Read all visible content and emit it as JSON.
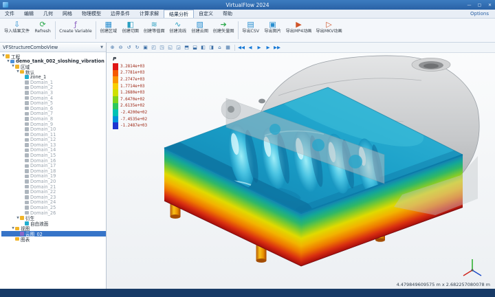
{
  "window": {
    "title": "VirtualFlow 2024",
    "minimize": "—",
    "maximize": "▢",
    "close": "✕",
    "options": "Options"
  },
  "menu": {
    "items": [
      "文件",
      "编辑",
      "几何",
      "网格",
      "物理模型",
      "边界条件",
      "计算求解",
      "结果分析",
      "自定义",
      "帮助"
    ],
    "active_index": 7
  },
  "ribbon": {
    "groups": [
      {
        "buttons": [
          {
            "id": "import-results",
            "label": "导入结果文件",
            "glyph": "⇩",
            "color": "#2a8fd0"
          },
          {
            "id": "refresh",
            "label": "Refresh",
            "glyph": "⟳",
            "color": "#2aa84a"
          }
        ]
      },
      {
        "buttons": [
          {
            "id": "create-variable",
            "label": "Create Variable",
            "glyph": "ƒ",
            "color": "#8a5fc0"
          }
        ]
      },
      {
        "buttons": [
          {
            "id": "create-region",
            "label": "创建区域",
            "glyph": "▦",
            "color": "#2a8fd0"
          },
          {
            "id": "create-slice",
            "label": "创建切面",
            "glyph": "◧",
            "color": "#2a9fc0"
          },
          {
            "id": "create-isosurface",
            "label": "创建等值面",
            "glyph": "≋",
            "color": "#2a9fc0"
          },
          {
            "id": "create-streamline",
            "label": "创建流线",
            "glyph": "∿",
            "color": "#2a9fc0"
          },
          {
            "id": "create-contour",
            "label": "创建云图",
            "glyph": "▨",
            "color": "#2a8fd0"
          },
          {
            "id": "create-vector",
            "label": "创建矢量图",
            "glyph": "➔",
            "color": "#2aa84a"
          }
        ]
      },
      {
        "buttons": [
          {
            "id": "export-csv",
            "label": "导出CSV",
            "glyph": "▤",
            "color": "#2a8fd0"
          },
          {
            "id": "export-image",
            "label": "导出图片",
            "glyph": "▣",
            "color": "#2a8fd0"
          },
          {
            "id": "export-mp4",
            "label": "导出MP4动画",
            "glyph": "▶",
            "color": "#d0552a"
          },
          {
            "id": "export-mkv",
            "label": "导出MKV动画",
            "glyph": "▷",
            "color": "#d0552a"
          }
        ]
      }
    ]
  },
  "sidebar": {
    "header": "VFStructureComboView",
    "tree": [
      {
        "label": "工程",
        "depth": 0,
        "icon": "folder",
        "exp": true
      },
      {
        "label": "demo_tank_002_sloshing_vibration",
        "depth": 1,
        "icon": "project",
        "exp": true,
        "bold": true
      },
      {
        "label": "区域",
        "depth": 2,
        "icon": "folder",
        "exp": true
      },
      {
        "label": "默认",
        "depth": 3,
        "icon": "folder",
        "exp": true
      },
      {
        "label": "zone_1",
        "depth": 4,
        "icon": "zone"
      },
      {
        "label": "Domain_1",
        "depth": 4,
        "icon": "domain",
        "gray": true
      },
      {
        "label": "Domain_2",
        "depth": 4,
        "icon": "domain",
        "gray": true
      },
      {
        "label": "Domain_3",
        "depth": 4,
        "icon": "domain",
        "gray": true
      },
      {
        "label": "Domain_4",
        "depth": 4,
        "icon": "domain",
        "gray": true
      },
      {
        "label": "Domain_5",
        "depth": 4,
        "icon": "domain",
        "gray": true
      },
      {
        "label": "Domain_6",
        "depth": 4,
        "icon": "domain",
        "gray": true
      },
      {
        "label": "Domain_7",
        "depth": 4,
        "icon": "domain",
        "gray": true
      },
      {
        "label": "Domain_8",
        "depth": 4,
        "icon": "domain",
        "gray": true
      },
      {
        "label": "Domain_9",
        "depth": 4,
        "icon": "domain",
        "gray": true
      },
      {
        "label": "Domain_10",
        "depth": 4,
        "icon": "domain",
        "gray": true
      },
      {
        "label": "Domain_11",
        "depth": 4,
        "icon": "domain",
        "gray": true
      },
      {
        "label": "Domain_12",
        "depth": 4,
        "icon": "domain",
        "gray": true
      },
      {
        "label": "Domain_13",
        "depth": 4,
        "icon": "domain",
        "gray": true
      },
      {
        "label": "Domain_14",
        "depth": 4,
        "icon": "domain",
        "gray": true
      },
      {
        "label": "Domain_15",
        "depth": 4,
        "icon": "domain",
        "gray": true
      },
      {
        "label": "Domain_16",
        "depth": 4,
        "icon": "domain",
        "gray": true
      },
      {
        "label": "Domain_17",
        "depth": 4,
        "icon": "domain",
        "gray": true
      },
      {
        "label": "Domain_18",
        "depth": 4,
        "icon": "domain",
        "gray": true
      },
      {
        "label": "Domain_19",
        "depth": 4,
        "icon": "domain",
        "gray": true
      },
      {
        "label": "Domain_20",
        "depth": 4,
        "icon": "domain",
        "gray": true
      },
      {
        "label": "Domain_21",
        "depth": 4,
        "icon": "domain",
        "gray": true
      },
      {
        "label": "Domain_22",
        "depth": 4,
        "icon": "domain",
        "gray": true
      },
      {
        "label": "Domain_23",
        "depth": 4,
        "icon": "domain",
        "gray": true
      },
      {
        "label": "Domain_24",
        "depth": 4,
        "icon": "domain",
        "gray": true
      },
      {
        "label": "Domain_25",
        "depth": 4,
        "icon": "domain",
        "gray": true
      },
      {
        "label": "Domain_26",
        "depth": 4,
        "icon": "domain",
        "gray": true
      },
      {
        "label": "衍生",
        "depth": 3,
        "icon": "folder",
        "exp": true
      },
      {
        "label": "自由液面",
        "depth": 4,
        "icon": "surface"
      },
      {
        "label": "视图",
        "depth": 2,
        "icon": "folder",
        "exp": true
      },
      {
        "label": "云图_02",
        "depth": 3,
        "icon": "view",
        "sel": true
      },
      {
        "label": "图表",
        "depth": 2,
        "icon": "folder"
      }
    ]
  },
  "viewport": {
    "tools": [
      {
        "name": "zoom-in-icon",
        "glyph": "⊕"
      },
      {
        "name": "zoom-out-icon",
        "glyph": "⊖"
      },
      {
        "name": "rotate-left-icon",
        "glyph": "↺"
      },
      {
        "name": "rotate-right-icon",
        "glyph": "↻"
      },
      {
        "name": "fit-view-icon",
        "glyph": "▣"
      },
      {
        "name": "view-front-icon",
        "glyph": "◰"
      },
      {
        "name": "view-back-icon",
        "glyph": "◳"
      },
      {
        "name": "view-left-icon",
        "glyph": "◱"
      },
      {
        "name": "view-right-icon",
        "glyph": "◲"
      },
      {
        "name": "view-top-icon",
        "glyph": "⬒"
      },
      {
        "name": "view-bottom-icon",
        "glyph": "⬓"
      },
      {
        "name": "view-iso-icon",
        "glyph": "◧"
      },
      {
        "name": "perspective-icon",
        "glyph": "◨"
      },
      {
        "name": "home-view-icon",
        "glyph": "⌂"
      },
      {
        "name": "grid-icon",
        "glyph": "▦"
      }
    ],
    "playback": [
      {
        "name": "skip-start-icon",
        "glyph": "◀◀"
      },
      {
        "name": "step-back-icon",
        "glyph": "◀"
      },
      {
        "name": "play-icon",
        "glyph": "▶"
      },
      {
        "name": "step-forward-icon",
        "glyph": "▶"
      },
      {
        "name": "skip-end-icon",
        "glyph": "▶▶"
      }
    ],
    "legend": {
      "title": "P",
      "entries": [
        {
          "value": "3.2814e+03",
          "color": "#e01616"
        },
        {
          "value": "2.7781e+03",
          "color": "#f55a00"
        },
        {
          "value": "2.2747e+03",
          "color": "#fb9500"
        },
        {
          "value": "1.7714e+03",
          "color": "#f7cf00"
        },
        {
          "value": "1.2680e+03",
          "color": "#cfe000"
        },
        {
          "value": "7.6470e+02",
          "color": "#7fd41c"
        },
        {
          "value": "2.6135e+02",
          "color": "#2cc85c"
        },
        {
          "value": "-2.4200e+02",
          "color": "#00c2b4"
        },
        {
          "value": "-7.4535e+02",
          "color": "#0092dc"
        },
        {
          "value": "-1.2487e+03",
          "color": "#1f35d0"
        }
      ]
    },
    "coords": "4.479849609575 m x 2.682257080078 m"
  }
}
